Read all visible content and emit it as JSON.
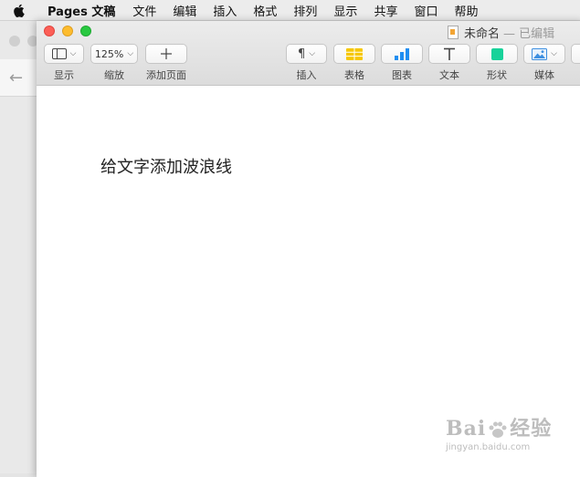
{
  "menubar": {
    "app_name": "Pages 文稿",
    "items": [
      "文件",
      "编辑",
      "插入",
      "格式",
      "排列",
      "显示",
      "共享",
      "窗口",
      "帮助"
    ]
  },
  "window": {
    "title": "未命名",
    "status": "— 已编辑"
  },
  "toolbar": {
    "view_label": "显示",
    "zoom_value": "125%",
    "zoom_label": "缩放",
    "add_page_label": "添加页面",
    "insert_label": "插入",
    "table_label": "表格",
    "chart_label": "图表",
    "text_label": "文本",
    "shape_label": "形状",
    "media_label": "媒体"
  },
  "document": {
    "body_text": "给文字添加波浪线"
  },
  "watermark": {
    "brand_left": "Bai",
    "brand_right": "经验",
    "url": "jingyan.baidu.com"
  },
  "colors": {
    "close": "#fc5f57",
    "minimize": "#fdbc2e",
    "maximize": "#28c840",
    "table_icon": "#f6c700",
    "chart_icon": "#1f8ef1",
    "shape_icon": "#18d29a",
    "media_icon": "#3d8fe0"
  }
}
